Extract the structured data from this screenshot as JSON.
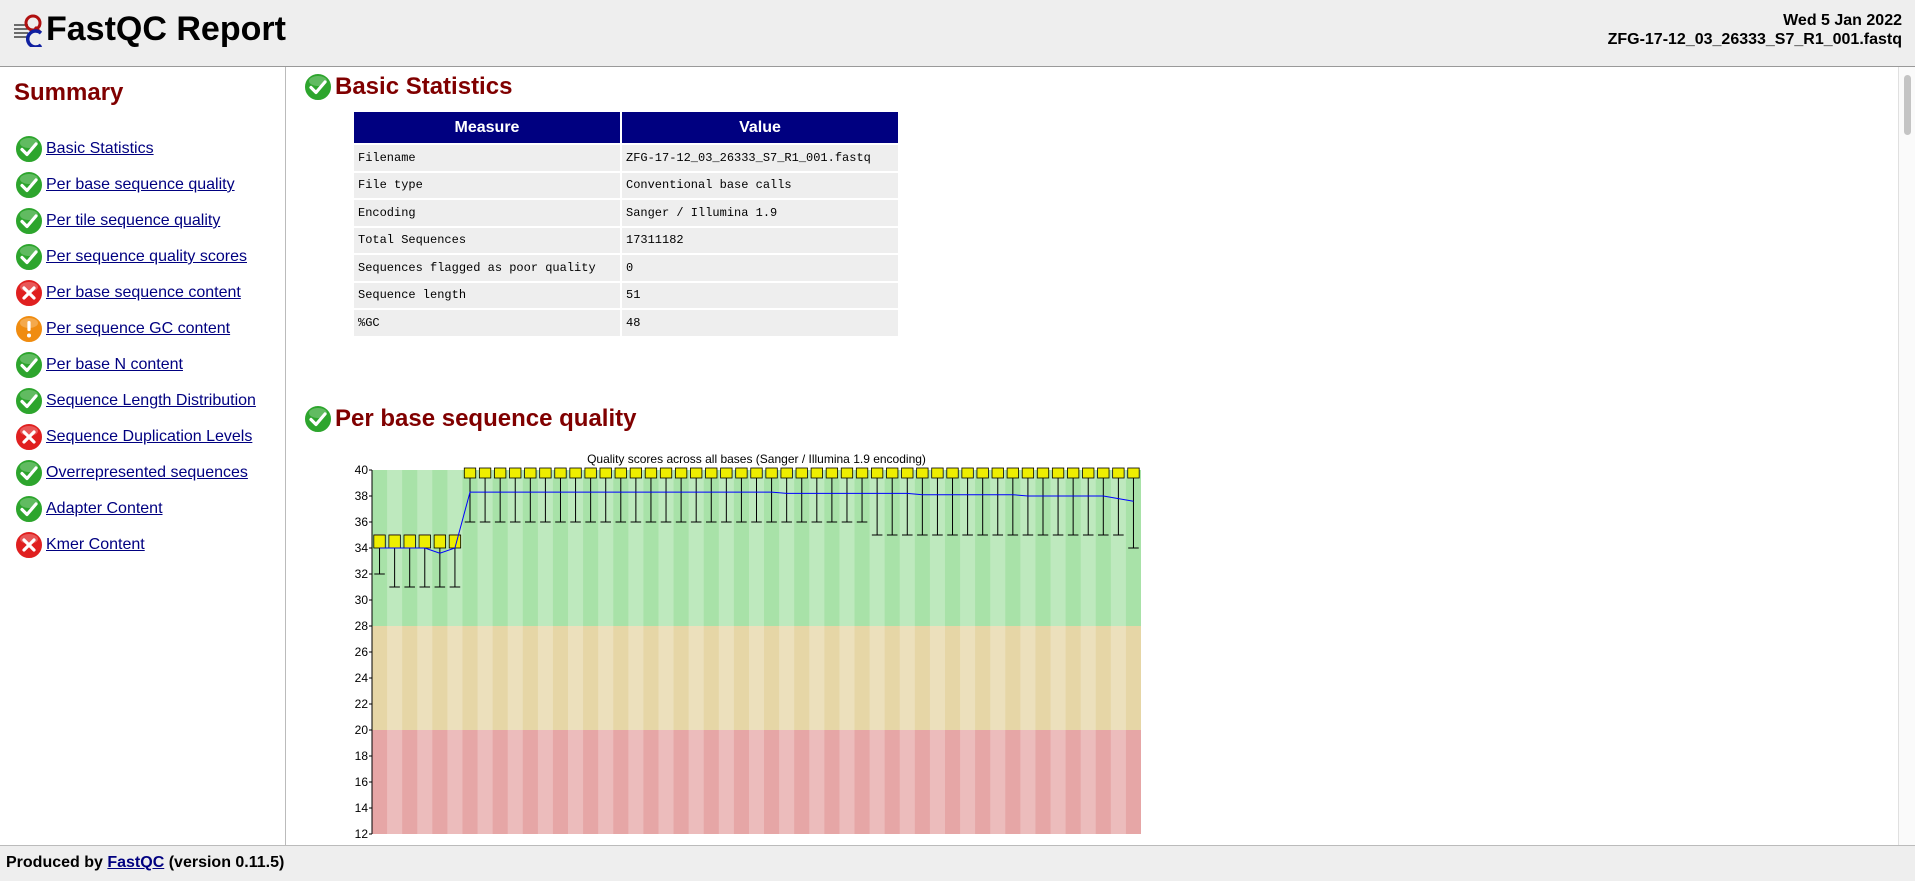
{
  "header": {
    "title": "FastQC Report",
    "date": "Wed 5 Jan 2022",
    "filename": "ZFG-17-12_03_26333_S7_R1_001.fastq"
  },
  "summary": {
    "title": "Summary",
    "items": [
      {
        "label": "Basic Statistics",
        "status": "pass"
      },
      {
        "label": "Per base sequence quality",
        "status": "pass"
      },
      {
        "label": "Per tile sequence quality",
        "status": "pass"
      },
      {
        "label": "Per sequence quality scores",
        "status": "pass"
      },
      {
        "label": "Per base sequence content",
        "status": "fail"
      },
      {
        "label": "Per sequence GC content",
        "status": "warn"
      },
      {
        "label": "Per base N content",
        "status": "pass"
      },
      {
        "label": "Sequence Length Distribution",
        "status": "pass"
      },
      {
        "label": "Sequence Duplication Levels",
        "status": "fail"
      },
      {
        "label": "Overrepresented sequences",
        "status": "pass"
      },
      {
        "label": "Adapter Content",
        "status": "pass"
      },
      {
        "label": "Kmer Content",
        "status": "fail"
      }
    ]
  },
  "basic_stats": {
    "title": "Basic Statistics",
    "headers": [
      "Measure",
      "Value"
    ],
    "rows": [
      [
        "Filename",
        "ZFG-17-12_03_26333_S7_R1_001.fastq"
      ],
      [
        "File type",
        "Conventional base calls"
      ],
      [
        "Encoding",
        "Sanger / Illumina 1.9"
      ],
      [
        "Total Sequences",
        "17311182"
      ],
      [
        "Sequences flagged as poor quality",
        "0"
      ],
      [
        "Sequence length",
        "51"
      ],
      [
        "%GC",
        "48"
      ]
    ]
  },
  "per_base_quality": {
    "title": "Per base sequence quality"
  },
  "chart_data": {
    "type": "box",
    "title": "Quality scores across all bases (Sanger / Illumina 1.9 encoding)",
    "y_ticks": [
      12,
      14,
      16,
      18,
      20,
      22,
      24,
      26,
      28,
      30,
      32,
      34,
      36,
      38,
      40
    ],
    "ylim": [
      12,
      40
    ],
    "zones": [
      {
        "from": 28,
        "to": 40,
        "color": "#a8e2a8"
      },
      {
        "from": 20,
        "to": 28,
        "color": "#e6d6a6"
      },
      {
        "from": 0,
        "to": 20,
        "color": "#e6a6a6"
      }
    ],
    "positions": 51,
    "mean": [
      34,
      34,
      34,
      34,
      33.6,
      34,
      38.3,
      38.3,
      38.3,
      38.3,
      38.3,
      38.3,
      38.3,
      38.3,
      38.3,
      38.3,
      38.3,
      38.3,
      38.3,
      38.3,
      38.3,
      38.3,
      38.3,
      38.3,
      38.3,
      38.3,
      38.3,
      38.2,
      38.2,
      38.2,
      38.2,
      38.2,
      38.2,
      38.2,
      38.2,
      38.2,
      38.1,
      38.1,
      38.1,
      38.1,
      38.1,
      38.1,
      38.1,
      38.0,
      38.0,
      38.0,
      38.0,
      38.0,
      38.0,
      37.8,
      37.6
    ],
    "lower_whisker": [
      32,
      31,
      31,
      31,
      31,
      31,
      36,
      36,
      36,
      36,
      36,
      36,
      36,
      36,
      36,
      36,
      36,
      36,
      36,
      36,
      36,
      36,
      36,
      36,
      36,
      36,
      36,
      36,
      36,
      36,
      36,
      36,
      36,
      35,
      35,
      35,
      35,
      35,
      35,
      35,
      35,
      35,
      35,
      35,
      35,
      35,
      35,
      35,
      35,
      35,
      34
    ],
    "upper_whisker": [
      35,
      35,
      35,
      35,
      35,
      35,
      40,
      40,
      40,
      40,
      40,
      40,
      40,
      40,
      40,
      40,
      40,
      40,
      40,
      40,
      40,
      40,
      40,
      40,
      40,
      40,
      40,
      40,
      40,
      40,
      40,
      40,
      40,
      40,
      40,
      40,
      40,
      40,
      40,
      40,
      40,
      40,
      40,
      40,
      40,
      40,
      40,
      40,
      40,
      40,
      40
    ],
    "box_low": [
      34,
      34,
      34,
      34,
      34,
      34,
      40,
      40,
      40,
      40,
      40,
      40,
      40,
      40,
      40,
      40,
      40,
      40,
      40,
      40,
      40,
      40,
      40,
      40,
      40,
      40,
      40,
      40,
      40,
      40,
      40,
      40,
      40,
      40,
      40,
      40,
      40,
      40,
      40,
      40,
      40,
      40,
      40,
      40,
      40,
      40,
      40,
      40,
      40,
      40,
      40
    ],
    "box_high": [
      35,
      35,
      35,
      35,
      35,
      35,
      40,
      40,
      40,
      40,
      40,
      40,
      40,
      40,
      40,
      40,
      40,
      40,
      40,
      40,
      40,
      40,
      40,
      40,
      40,
      40,
      40,
      40,
      40,
      40,
      40,
      40,
      40,
      40,
      40,
      40,
      40,
      40,
      40,
      40,
      40,
      40,
      40,
      40,
      40,
      40,
      40,
      40,
      40,
      40,
      40
    ],
    "box_color": "#eeee00",
    "mean_color": "#0000ff"
  },
  "footer": {
    "prefix": "Produced by",
    "link": "FastQC",
    "suffix": "(version 0.11.5)"
  },
  "colors": {
    "header_bg": "#eeeeee",
    "section_title": "#800000",
    "link": "#000080",
    "table_header": "#000080",
    "pass": "#2da52d",
    "fail": "#e02020",
    "warn": "#f08c10"
  }
}
